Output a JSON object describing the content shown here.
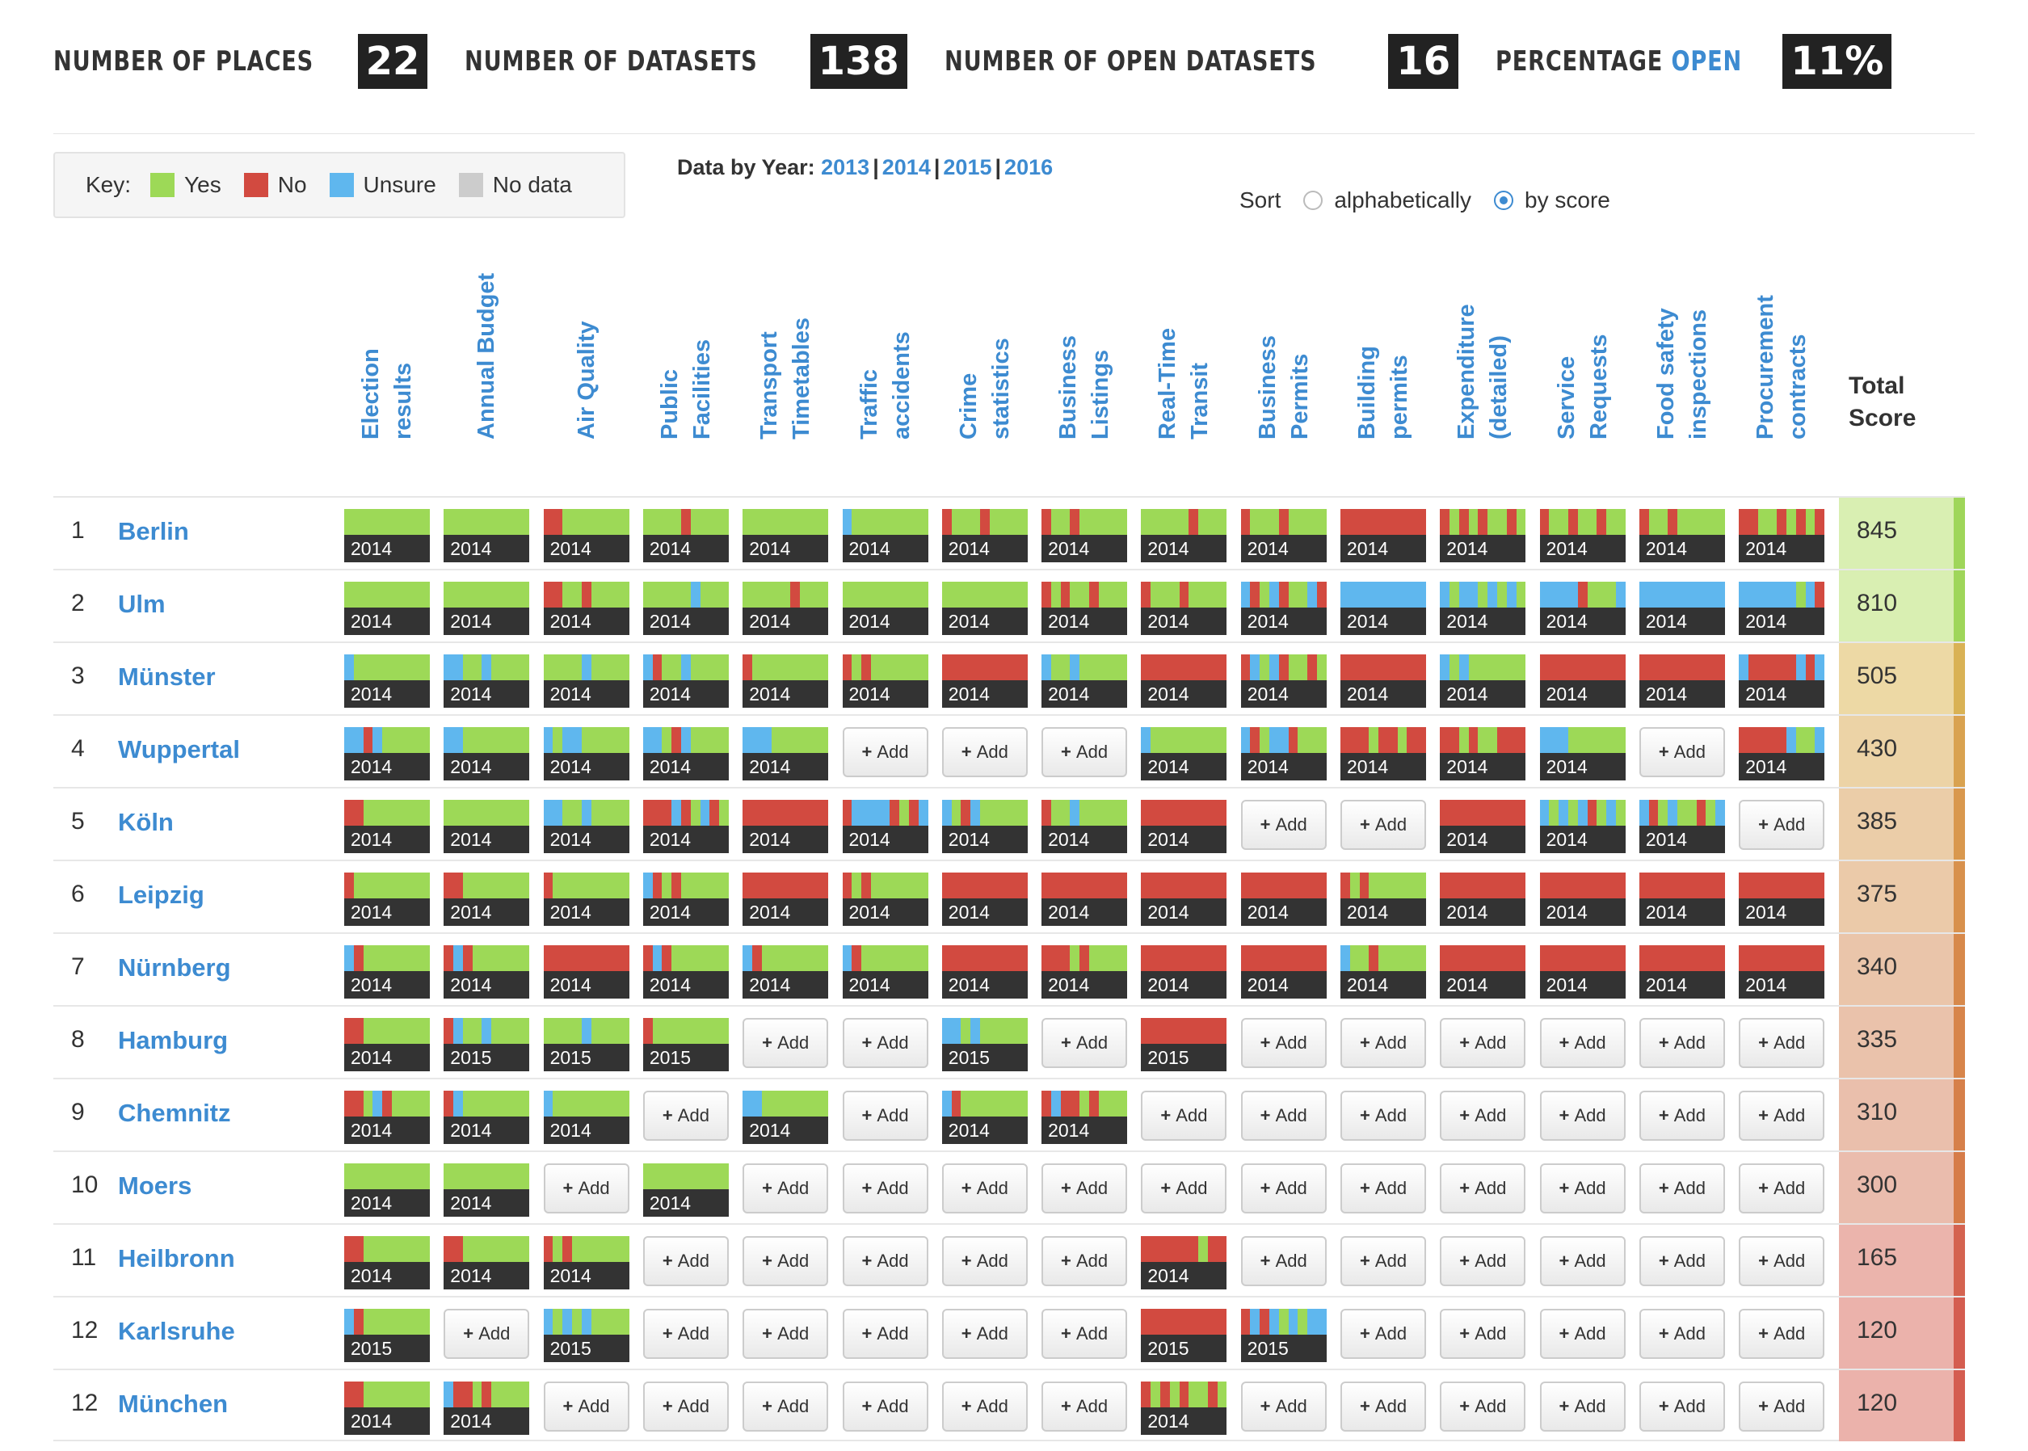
{
  "stats": [
    {
      "label": "NUMBER OF PLACES",
      "value": "22"
    },
    {
      "label": "NUMBER OF DATASETS",
      "value": "138"
    },
    {
      "label": "NUMBER OF OPEN DATASETS",
      "value": "16"
    },
    {
      "label_pre": "PERCENTAGE ",
      "label_hl": "OPEN",
      "value": "11%"
    }
  ],
  "key": {
    "label": "Key:",
    "items": [
      {
        "label": "Yes",
        "color": "#9dd957"
      },
      {
        "label": "No",
        "color": "#d24a40"
      },
      {
        "label": "Unsure",
        "color": "#5fb7ee"
      },
      {
        "label": "No data",
        "color": "#cccccc"
      }
    ]
  },
  "years": {
    "label": "Data by Year:",
    "links": [
      "2013",
      "2014",
      "2015",
      "2016"
    ]
  },
  "sort": {
    "label": "Sort",
    "options": [
      {
        "label": "alphabetically",
        "checked": false
      },
      {
        "label": "by score",
        "checked": true
      }
    ]
  },
  "columns": [
    "Election results",
    "Annual Budget",
    "Air Quality",
    "Public Facilities",
    "Transport Timetables",
    "Traffic accidents",
    "Crime statistics",
    "Business Listings",
    "Real-Time Transit",
    "Business Permits",
    "Building permits",
    "Expenditure (detailed)",
    "Service Requests",
    "Food safety inspections",
    "Procurement contracts"
  ],
  "total_label": "Total Score",
  "add_label": "Add",
  "colors": {
    "Y": "#9dd957",
    "N": "#d24a40",
    "U": "#5fb7ee"
  },
  "rows": [
    {
      "rank": "1",
      "name": "Berlin",
      "score": "845",
      "score_bg": "#d9efb2",
      "stripe": "#9fd65a",
      "cells": [
        [
          "2014",
          "YYYYYYYYY"
        ],
        [
          "2014",
          "YYYYYYYYY"
        ],
        [
          "2014",
          "NNYYYYYYY"
        ],
        [
          "2014",
          "YYYYNYYYY"
        ],
        [
          "2014",
          "YYYYYYYYY"
        ],
        [
          "2014",
          "UYYYYYYYY"
        ],
        [
          "2014",
          "NYYYNYYYY"
        ],
        [
          "2014",
          "NYYNYYYYY"
        ],
        [
          "2014",
          "YYYYYNYYY"
        ],
        [
          "2014",
          "NYYYNYYYY"
        ],
        [
          "2014",
          "NNNNNNNNN"
        ],
        [
          "2014",
          "NYNYNYYNY"
        ],
        [
          "2014",
          "NYYNYYNYY"
        ],
        [
          "2014",
          "NYYNYYYYY"
        ],
        [
          "2014",
          "NNYYNYNYN"
        ]
      ]
    },
    {
      "rank": "2",
      "name": "Ulm",
      "score": "810",
      "score_bg": "#d9efb2",
      "stripe": "#9fd65a",
      "cells": [
        [
          "2014",
          "YYYYYYYYY"
        ],
        [
          "2014",
          "YYYYYYYYY"
        ],
        [
          "2014",
          "NNYYNYYYY"
        ],
        [
          "2014",
          "YYYYYUYYY"
        ],
        [
          "2014",
          "YYYYYNYYY"
        ],
        [
          "2014",
          "YYYYYYYYY"
        ],
        [
          "2014",
          "YYYYYYYYY"
        ],
        [
          "2014",
          "NYNYYNYYY"
        ],
        [
          "2014",
          "NYYYNYYYY"
        ],
        [
          "2014",
          "UNYUNYYUN"
        ],
        [
          "2014",
          "UUUUUUUUU"
        ],
        [
          "2014",
          "UYUUYUYUY"
        ],
        [
          "2014",
          "UUUUNYYYU"
        ],
        [
          "2014",
          "UUUUUUUUU"
        ],
        [
          "2014",
          "UUUUUUYUN"
        ]
      ]
    },
    {
      "rank": "3",
      "name": "Münster",
      "score": "505",
      "score_bg": "#edd9a5",
      "stripe": "#d9b255",
      "cells": [
        [
          "2014",
          "UYYYYYYYY"
        ],
        [
          "2014",
          "UUYYUYYYY"
        ],
        [
          "2014",
          "YYYYUYYYY"
        ],
        [
          "2014",
          "UNYYUYYYY"
        ],
        [
          "2014",
          "NYYYYYYYY"
        ],
        [
          "2014",
          "NYNYYYYYY"
        ],
        [
          "2014",
          "NNNNNNNNN"
        ],
        [
          "2014",
          "UYYUYYYYY"
        ],
        [
          "2014",
          "NNNNNNNNN"
        ],
        [
          "2014",
          "NUYUNYYNY"
        ],
        [
          "2014",
          "NNNNNNNNN"
        ],
        [
          "2014",
          "UYUYYYYYY"
        ],
        [
          "2014",
          "NNNNNNNNN"
        ],
        [
          "2014",
          "NNNNNNNNN"
        ],
        [
          "2014",
          "UNNNNNUNU"
        ]
      ]
    },
    {
      "rank": "4",
      "name": "Wuppertal",
      "score": "430",
      "score_bg": "#ecd3a6",
      "stripe": "#d9a250",
      "cells": [
        [
          "2014",
          "UUNUYYYYY"
        ],
        [
          "2014",
          "UUYYYYYYY"
        ],
        [
          "2014",
          "UYUUYYYYY"
        ],
        [
          "2014",
          "UUYNUYYYY"
        ],
        [
          "2014",
          "UUUYYYYYY"
        ],
        null,
        null,
        null,
        [
          "2014",
          "UYYYYYYYY"
        ],
        [
          "2014",
          "UNYUUNYYY"
        ],
        [
          "2014",
          "NNNYNNYNN"
        ],
        [
          "2014",
          "NNYNYYNNN"
        ],
        [
          "2014",
          "UUUYYYYYY"
        ],
        null,
        [
          "2014",
          "NNNNNUYYU"
        ]
      ]
    },
    {
      "rank": "5",
      "name": "Köln",
      "score": "385",
      "score_bg": "#ebcda8",
      "stripe": "#d9984e",
      "cells": [
        [
          "2014",
          "NNYYYYYYY"
        ],
        [
          "2014",
          "YYYYYYYYY"
        ],
        [
          "2014",
          "UUYYUYYYY"
        ],
        [
          "2014",
          "NNNUNYUNY"
        ],
        [
          "2014",
          "NNNNNNNNN"
        ],
        [
          "2014",
          "NUUUUNYNU"
        ],
        [
          "2014",
          "UYNUYYYYY"
        ],
        [
          "2014",
          "NYYUYYYYY"
        ],
        [
          "2014",
          "NNNNNNNNN"
        ],
        null,
        null,
        [
          "2014",
          "NNNNNNNNN"
        ],
        [
          "2014",
          "UYUYUNYUY"
        ],
        [
          "2014",
          "UNYUYYNYU"
        ],
        null
      ]
    },
    {
      "rank": "6",
      "name": "Leipzig",
      "score": "375",
      "score_bg": "#ebcaa9",
      "stripe": "#d8914d",
      "cells": [
        [
          "2014",
          "NYYYYYYYY"
        ],
        [
          "2014",
          "NNYYYYYYY"
        ],
        [
          "2014",
          "NYYYYYYYY"
        ],
        [
          "2014",
          "UNYNYYYYY"
        ],
        [
          "2014",
          "NNNNNNNNN"
        ],
        [
          "2014",
          "NYNYYYYYY"
        ],
        [
          "2014",
          "NNNNNNNNN"
        ],
        [
          "2014",
          "NNNNNNNNN"
        ],
        [
          "2014",
          "NNNNNNNNN"
        ],
        [
          "2014",
          "NNNNNNNNN"
        ],
        [
          "2014",
          "NYNYYYYYY"
        ],
        [
          "2014",
          "NNNNNNNNN"
        ],
        [
          "2014",
          "NNNNNNNNN"
        ],
        [
          "2014",
          "NNNNNNNNN"
        ],
        [
          "2014",
          "NNNNNNNNN"
        ]
      ]
    },
    {
      "rank": "7",
      "name": "Nürnberg",
      "score": "340",
      "score_bg": "#eac5aa",
      "stripe": "#d7894b",
      "cells": [
        [
          "2014",
          "UNYYYYYYY"
        ],
        [
          "2014",
          "NUNYYYYYY"
        ],
        [
          "2014",
          "NNNNNNNNN"
        ],
        [
          "2014",
          "NUNYYYYYY"
        ],
        [
          "2014",
          "UNYYYYYYY"
        ],
        [
          "2014",
          "UNYYYYYYY"
        ],
        [
          "2014",
          "NNNNNNNNN"
        ],
        [
          "2014",
          "NNNYNYYYY"
        ],
        [
          "2014",
          "NNNNNNNNN"
        ],
        [
          "2014",
          "NNNNNNNNN"
        ],
        [
          "2014",
          "UYYNYYYYY"
        ],
        [
          "2014",
          "NNNNNNNNN"
        ],
        [
          "2014",
          "NNNNNNNNN"
        ],
        [
          "2014",
          "NNNNNNNNN"
        ],
        [
          "2014",
          "NNNNNNNNN"
        ]
      ]
    },
    {
      "rank": "8",
      "name": "Hamburg",
      "score": "335",
      "score_bg": "#eac2ab",
      "stripe": "#d7854b",
      "cells": [
        [
          "2014",
          "NNYYYYYYY"
        ],
        [
          "2015",
          "NUYYUYYYY"
        ],
        [
          "2015",
          "YYYYUYYYY"
        ],
        [
          "2015",
          "NYYYYYYYY"
        ],
        null,
        null,
        [
          "2015",
          "UUYUYYYYY"
        ],
        null,
        [
          "2015",
          "NNNNNNNNN"
        ],
        null,
        null,
        null,
        null,
        null,
        null
      ]
    },
    {
      "rank": "9",
      "name": "Chemnitz",
      "score": "310",
      "score_bg": "#eabfac",
      "stripe": "#d6804a",
      "cells": [
        [
          "2014",
          "NNYUNYYYY"
        ],
        [
          "2014",
          "NUYYYYYYY"
        ],
        [
          "2014",
          "UYYYYYYYY"
        ],
        null,
        [
          "2014",
          "UUYYYYYYY"
        ],
        null,
        [
          "2014",
          "UNYYYYYYY"
        ],
        [
          "2014",
          "NUNNYNYYY"
        ],
        null,
        null,
        null,
        null,
        null,
        null,
        null
      ]
    },
    {
      "rank": "10",
      "name": "Moers",
      "score": "300",
      "score_bg": "#eabcad",
      "stripe": "#d67c49",
      "cells": [
        [
          "2014",
          "YYYYYYYYY"
        ],
        [
          "2014",
          "YYYYYYYYY"
        ],
        null,
        [
          "2014",
          "YYYYYYYYY"
        ],
        null,
        null,
        null,
        null,
        null,
        null,
        null,
        null,
        null,
        null,
        null
      ]
    },
    {
      "rank": "11",
      "name": "Heilbronn",
      "score": "165",
      "score_bg": "#ebb4ac",
      "stripe": "#d46350",
      "cells": [
        [
          "2014",
          "NNYYYYYYY"
        ],
        [
          "2014",
          "NNYYYYYYY"
        ],
        [
          "2014",
          "NYNYYYYYY"
        ],
        null,
        null,
        null,
        null,
        null,
        [
          "2014",
          "NNNNNNYNN"
        ],
        null,
        null,
        null,
        null,
        null,
        null
      ]
    },
    {
      "rank": "12",
      "name": "Karlsruhe",
      "score": "120",
      "score_bg": "#ebb2ab",
      "stripe": "#d45d50",
      "cells": [
        [
          "2015",
          "UNYYYYYYY"
        ],
        null,
        [
          "2015",
          "UYUYUYYYY"
        ],
        null,
        null,
        null,
        null,
        null,
        [
          "2015",
          "NNNNNNNNN"
        ],
        [
          "2015",
          "NUNUYUYUU"
        ],
        null,
        null,
        null,
        null,
        null
      ]
    },
    {
      "rank": "12",
      "name": "München",
      "score": "120",
      "score_bg": "#ebb2ab",
      "stripe": "#d45d50",
      "cells": [
        [
          "2014",
          "NNYYYYYYY"
        ],
        [
          "2014",
          "UNNYNYYYY"
        ],
        null,
        null,
        null,
        null,
        null,
        null,
        [
          "2014",
          "NYNYNYYNY"
        ],
        null,
        null,
        null,
        null,
        null,
        null
      ]
    }
  ]
}
